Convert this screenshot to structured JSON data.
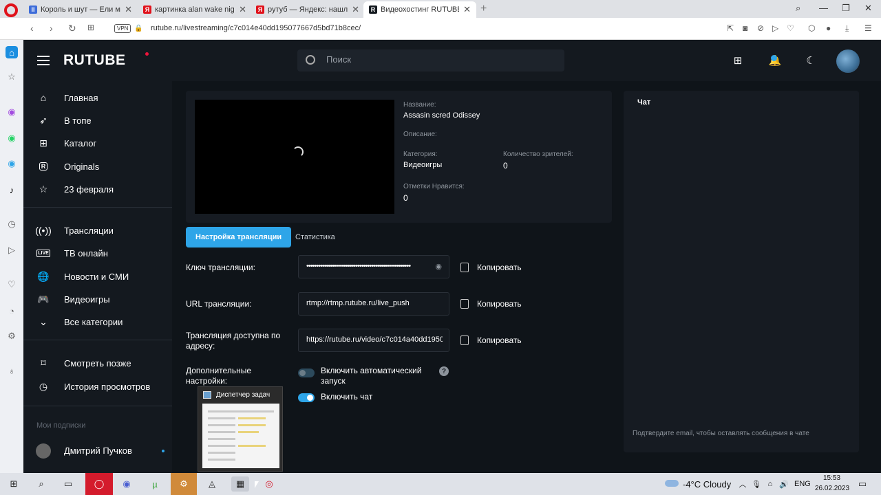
{
  "browser": {
    "tabs": [
      {
        "title": "Король и шут — Ели мясо",
        "favicon_color": "#3d6cd9",
        "favicon_glyph": "II"
      },
      {
        "title": "картинка alan wake night",
        "favicon_color": "#e0121b",
        "favicon_glyph": "Я"
      },
      {
        "title": "рутуб — Яндекс: нашлось",
        "favicon_color": "#e0121b",
        "favicon_glyph": "Я"
      },
      {
        "title": "Видеохостинг RUTUBE. Смо",
        "favicon_color": "#14191f",
        "favicon_glyph": "R"
      }
    ],
    "url": "rutube.ru/livestreaming/c7c014e40dd195077667d5bd71b8cec/",
    "vpn_label": "VPN"
  },
  "header": {
    "logo": "RUTUBE",
    "search_placeholder": "Поиск"
  },
  "sidebar": {
    "items": [
      {
        "label": "Главная",
        "icon": "home-icon"
      },
      {
        "label": "В топе",
        "icon": "rocket-icon"
      },
      {
        "label": "Каталог",
        "icon": "grid-icon"
      },
      {
        "label": "Originals",
        "icon": "originals-icon"
      },
      {
        "label": "23 февраля",
        "icon": "star-icon"
      },
      {
        "label": "Трансляции",
        "icon": "broadcast-icon"
      },
      {
        "label": "ТВ онлайн",
        "icon": "live-icon"
      },
      {
        "label": "Новости и СМИ",
        "icon": "globe-icon"
      },
      {
        "label": "Видеоигры",
        "icon": "gamepad-icon"
      },
      {
        "label": "Все категории",
        "icon": "chevron-down-icon"
      },
      {
        "label": "Смотреть позже",
        "icon": "bookmark-icon"
      },
      {
        "label": "История просмотров",
        "icon": "history-icon"
      }
    ],
    "live_badge": "LIVE",
    "subscriptions_title": "Мои подписки",
    "subscriptions": [
      {
        "name": "Дмитрий Пучков"
      }
    ]
  },
  "stream_info": {
    "name_label": "Название:",
    "name_value": "Assasin scred Odissey",
    "description_label": "Описание:",
    "category_label": "Категория:",
    "category_value": "Видеоигры",
    "viewers_label": "Количество зрителей:",
    "viewers_value": "0",
    "likes_label": "Отметки Нравится:",
    "likes_value": "0"
  },
  "tabs": {
    "settings": "Настройка трансляции",
    "stats": "Статистика"
  },
  "settings": {
    "key_label": "Ключ трансляции:",
    "key_value": "•••••••••••••••••••••••••••••••••••••••••••••••••••••",
    "url_label": "URL трансляции:",
    "url_value": "rtmp://rtmp.rutube.ru/live_push",
    "address_label": "Трансляция доступна по адресу:",
    "address_value": "https://rutube.ru/video/c7c014a40dd1950",
    "copy_label": "Копировать",
    "extra_label": "Дополнительные настройки:",
    "autostart_label": "Включить автоматический запуск",
    "chat_toggle_label": "Включить чат",
    "help_glyph": "?"
  },
  "chat": {
    "title": "Чат",
    "note": "Подтвердите email, чтобы оставлять сообщения в чате"
  },
  "taskbar": {
    "preview_title": "Диспетчер задач",
    "weather": "-4°C Cloudy",
    "lang": "ENG",
    "time": "15:53",
    "date": "26.02.2023"
  }
}
